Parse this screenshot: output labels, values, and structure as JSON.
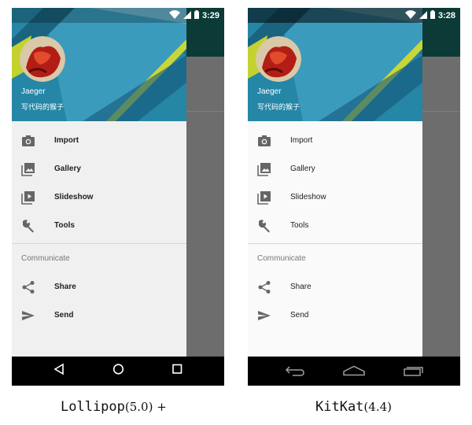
{
  "left_phone": {
    "status": {
      "time": "3:29"
    },
    "header": {
      "user_name": "Jaeger",
      "user_subtitle": "写代码的猴子"
    },
    "menu": [
      {
        "label": "Import",
        "icon": "camera-icon"
      },
      {
        "label": "Gallery",
        "icon": "gallery-icon"
      },
      {
        "label": "Slideshow",
        "icon": "slideshow-icon"
      },
      {
        "label": "Tools",
        "icon": "wrench-icon"
      }
    ],
    "section_title": "Communicate",
    "communicate": [
      {
        "label": "Share",
        "icon": "share-icon"
      },
      {
        "label": "Send",
        "icon": "send-icon"
      }
    ],
    "caption": {
      "name": "Lollipop",
      "version": "(5.0) +"
    }
  },
  "right_phone": {
    "status": {
      "time": "3:28"
    },
    "header": {
      "user_name": "Jaeger",
      "user_subtitle": "写代码的猴子"
    },
    "menu": [
      {
        "label": "Import",
        "icon": "camera-icon"
      },
      {
        "label": "Gallery",
        "icon": "gallery-icon"
      },
      {
        "label": "Slideshow",
        "icon": "slideshow-icon"
      },
      {
        "label": "Tools",
        "icon": "wrench-icon"
      }
    ],
    "section_title": "Communicate",
    "communicate": [
      {
        "label": "Share",
        "icon": "share-icon"
      },
      {
        "label": "Send",
        "icon": "send-icon"
      }
    ],
    "caption": {
      "name": "KitKat",
      "version": "(4.4)"
    }
  },
  "colors": {
    "header_blue": "#1a6d8a",
    "header_yellow": "#c4d22f",
    "app_bar": "#0c3a37",
    "scrim": "#6d6d6d",
    "icon_gray": "#666666"
  }
}
